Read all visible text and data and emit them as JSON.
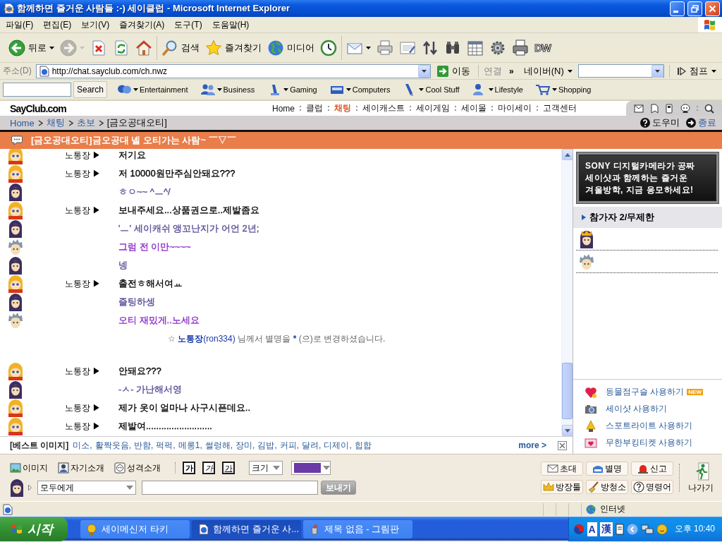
{
  "window": {
    "title": "함께하면 즐거운 사람들 :-) 세이클럽 - Microsoft Internet Explorer"
  },
  "menu": [
    "파일(F)",
    "편집(E)",
    "보기(V)",
    "즐겨찾기(A)",
    "도구(T)",
    "도움말(H)"
  ],
  "toolbar": {
    "groups": [
      [
        {
          "kind": "back",
          "label": "뒤로",
          "dropdown": true,
          "disabled": false
        },
        {
          "kind": "forward",
          "dropdown": true,
          "disabled": true
        },
        {
          "kind": "stop",
          "dropdown": false,
          "disabled": false
        },
        {
          "kind": "refresh",
          "dropdown": false,
          "disabled": false
        },
        {
          "kind": "home",
          "dropdown": false,
          "disabled": false
        }
      ],
      [
        {
          "kind": "search",
          "label": "검색",
          "dropdown": false,
          "disabled": false
        },
        {
          "kind": "favorites",
          "label": "즐겨찾기",
          "dropdown": false,
          "disabled": false
        },
        {
          "kind": "media",
          "label": "미디어",
          "dropdown": false,
          "disabled": false
        },
        {
          "kind": "history",
          "dropdown": false,
          "disabled": false
        }
      ],
      [
        {
          "kind": "mail",
          "dropdown": true,
          "disabled": false
        },
        {
          "kind": "print",
          "dropdown": false,
          "disabled": false
        },
        {
          "kind": "edit",
          "dropdown": false,
          "disabled": false
        },
        {
          "kind": "arrows",
          "dropdown": false,
          "disabled": false
        },
        {
          "kind": "binoculars",
          "dropdown": false,
          "disabled": false
        },
        {
          "kind": "calendar",
          "dropdown": false,
          "disabled": false
        },
        {
          "kind": "gear",
          "dropdown": false,
          "disabled": false
        },
        {
          "kind": "printer",
          "dropdown": false,
          "disabled": false
        },
        {
          "kind": "plugin",
          "label": "DW",
          "dropdown": false,
          "disabled": false
        }
      ]
    ]
  },
  "address_bar": {
    "label": "주소(D)",
    "url": "http://chat.sayclub.com/ch.nwz",
    "go": "이동",
    "links": "연결",
    "more": "»",
    "search_menu": "네이버(N)",
    "jump": "점프"
  },
  "links_bar": {
    "search_button": "Search",
    "links": [
      {
        "kind": "entertainment",
        "label": "Entertainment"
      },
      {
        "kind": "business",
        "label": "Business"
      },
      {
        "kind": "gaming",
        "label": "Gaming"
      },
      {
        "kind": "computers",
        "label": "Computers"
      },
      {
        "kind": "cool_stuff",
        "label": "Cool Stuff"
      },
      {
        "kind": "lifestyle",
        "label": "Lifestyle"
      },
      {
        "kind": "shopping",
        "label": "Shopping"
      }
    ]
  },
  "header": {
    "logo": "SayClub.com",
    "nav": [
      {
        "label": "Home",
        "selected": false
      },
      {
        "label": "클럽",
        "selected": false
      },
      {
        "label": "채팅",
        "selected": true
      },
      {
        "label": "세이캐스트",
        "selected": false
      },
      {
        "label": "세이게임",
        "selected": false
      },
      {
        "label": "세이몰",
        "selected": false
      },
      {
        "label": "마이세이",
        "selected": false
      },
      {
        "label": "고객센터",
        "selected": false
      }
    ]
  },
  "breadcrumb": {
    "items": [
      {
        "label": "Home",
        "kind": "link"
      },
      {
        "label": "채팅",
        "kind": "link"
      },
      {
        "label": "초보",
        "kind": "link"
      },
      {
        "label": "[금오공대오티]",
        "kind": "current"
      }
    ],
    "help": "도우미",
    "exit": "종료"
  },
  "room": {
    "title": "[금오공대오티]금오공대 녤 오티가는 사람~ ￣▽￣"
  },
  "chat": {
    "rows": [
      {
        "kind": "message",
        "avatar": {
          "kind": "helmet"
        },
        "nick": "노통장 ▶",
        "text": "저기요",
        "color": "#000000"
      },
      {
        "kind": "message",
        "avatar": {
          "kind": "helmet"
        },
        "nick": "노통장 ▶",
        "text": "저 10000원만주심안돼요???",
        "color": "#000000"
      },
      {
        "kind": "message",
        "avatar": {
          "kind": "long_hair"
        },
        "text": "ㅎㅇ~~ ^ㅡ^/",
        "color": "#574c94"
      },
      {
        "kind": "message",
        "avatar": {
          "kind": "helmet"
        },
        "nick": "노통장 ▶",
        "text": "보내주세요...상품권으로..제발좀요",
        "color": "#000000"
      },
      {
        "kind": "message",
        "avatar": {
          "kind": "long_hair"
        },
        "text": "'ㅡ' 세이캐쉬 앵꼬난지가 어언 2년;",
        "color": "#574c94"
      },
      {
        "kind": "message",
        "avatar": {
          "kind": "gray_hair"
        },
        "text": "그럼 전 이만~~~~",
        "color": "#8a2cc8"
      },
      {
        "kind": "message",
        "avatar": {
          "kind": "long_hair"
        },
        "text": "넹",
        "color": "#574c94"
      },
      {
        "kind": "message",
        "avatar": {
          "kind": "helmet"
        },
        "nick": "노통장 ▶",
        "text": "출전ㅎ해서여ㅛ",
        "color": "#000000"
      },
      {
        "kind": "message",
        "avatar": {
          "kind": "long_hair"
        },
        "text": "즐팅하셍",
        "color": "#574c94"
      },
      {
        "kind": "message",
        "avatar": {
          "kind": "gray_hair"
        },
        "text": "오티 재밌게..노세요",
        "color": "#8a2cc8"
      },
      {
        "kind": "notice",
        "star": "☆",
        "nick": "노통장",
        "user_id": "(ron334)",
        "text": "님께서 별명을",
        "new_nick": "*",
        "rest": "(으)로 변경하셨습니다."
      },
      {
        "kind": "message",
        "avatar": {
          "kind": "helmet"
        },
        "nick": "노통장 ▶",
        "text": "안돼요???",
        "color": "#000000"
      },
      {
        "kind": "message",
        "avatar": {
          "kind": "long_hair"
        },
        "text": "-ㅅ- 가난해서영",
        "color": "#574c94"
      },
      {
        "kind": "message",
        "avatar": {
          "kind": "helmet"
        },
        "nick": "노통장 ▶",
        "text": "제가 옷이 얼마나 사구시픈데요..",
        "color": "#000000"
      },
      {
        "kind": "message",
        "avatar": {
          "kind": "helmet"
        },
        "nick": "노통장 ▶",
        "text": "제발여..........................",
        "color": "#000000"
      }
    ]
  },
  "best_images": {
    "label": "[베스트 이미지]",
    "items": [
      "미소,",
      "활짝웃음,",
      "반함,",
      "퍽퍽,",
      "메롱1,",
      "썰렁해,",
      "장미,",
      "김밥,",
      "커피,",
      "달려,",
      "디제이,",
      "힙합"
    ],
    "more": "more >"
  },
  "sidebar": {
    "ad": [
      "SONY 디지털카메라가 공짜",
      "세이샷과 함께하는 즐거운",
      "겨울방학, 지금 응모하세요!"
    ],
    "participants": {
      "title": "참가자 2/무제한",
      "members": [
        {
          "avatar": {
            "kind": "crowned"
          }
        },
        {
          "avatar": {
            "kind": "gray_hair"
          }
        }
      ]
    },
    "features": [
      {
        "kind": "fortune",
        "label": "동물점구슬 사용하기",
        "badge": "NEW"
      },
      {
        "kind": "camera",
        "label": "세이샷 사용하기"
      },
      {
        "kind": "spotlight",
        "label": "스포트라이트 사용하기"
      },
      {
        "kind": "ticket",
        "label": "무한부킹티켓 사용하기"
      }
    ]
  },
  "composer": {
    "tools": [
      {
        "kind": "image",
        "label": "이미지"
      },
      {
        "kind": "profile",
        "label": "자기소개"
      },
      {
        "kind": "personality",
        "label": "성격소개"
      }
    ],
    "styles": [
      {
        "kind": "bold",
        "label": "가"
      },
      {
        "kind": "italic",
        "label": "가"
      },
      {
        "kind": "underline",
        "label": "가"
      }
    ],
    "size": "크기",
    "color": "#6a3aa6",
    "avatar": {
      "kind": "long_hair"
    },
    "target": "모두에게",
    "send": "보내기",
    "actions": [
      {
        "kind": "invite",
        "label": "초대"
      },
      {
        "kind": "nickname",
        "label": "별명"
      },
      {
        "kind": "report",
        "label": "신고"
      },
      {
        "kind": "owner",
        "label": "방장툴"
      },
      {
        "kind": "cleanup",
        "label": "방청소"
      },
      {
        "kind": "commands",
        "label": "명령어"
      }
    ],
    "exit": "나가기"
  },
  "status_bar": {
    "zone": "인터넷"
  },
  "taskbar": {
    "start": "시작",
    "tasks": [
      {
        "kind": "messenger",
        "label": "세이메신저 타키",
        "selected": false
      },
      {
        "kind": "browser",
        "label": "함께하면 즐거운 사...",
        "selected": true
      },
      {
        "kind": "paint",
        "label": "제목 없음 - 그림판",
        "selected": false
      }
    ],
    "ime": [
      "A",
      "漢"
    ],
    "time": "오후 10:40"
  }
}
